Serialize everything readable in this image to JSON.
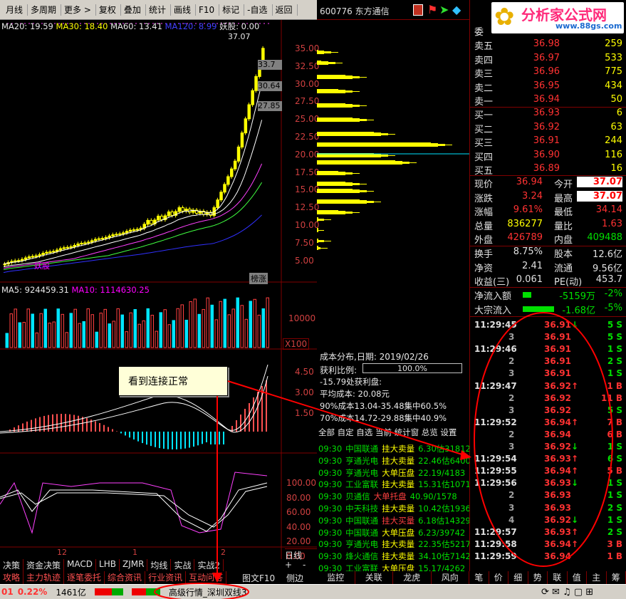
{
  "toolbar": {
    "items": [
      "月线",
      "多周期",
      "更多 >",
      "复权",
      "叠加",
      "统计",
      "画线",
      "F10",
      "标记",
      "-自选",
      "返回"
    ]
  },
  "stock": {
    "code_name": "600776 东方通信"
  },
  "logo": {
    "text": "分析家公式网",
    "url": "www.88gs.com"
  },
  "ma_line": {
    "ma20": "MA20: 19.59",
    "ma30": "MA30: 18.40",
    "ma60": "MA60: 13.41",
    "ma120": "MA120: 8.99",
    "yaogu": "妖股: 0.00"
  },
  "price_axis": [
    "35.00",
    "32.50",
    "30.00",
    "27.50",
    "25.00",
    "22.50",
    "20.00",
    "17.50",
    "15.00",
    "12.50",
    "10.00",
    "7.50",
    "5.00"
  ],
  "price_marks": {
    "high": "37.07",
    "p1": "33.7",
    "p2": "30.64",
    "p3": "27.85",
    "yaogu_label": "妖股",
    "tag": "榜涨"
  },
  "vol": {
    "ma5": "MA5: 924459.31",
    "ma10": "MA10: 1114630.25",
    "axis": "10000",
    "unit": "X100"
  },
  "macd_axis": [
    "4.50",
    "3.00",
    "1.50"
  ],
  "kdj_axis": [
    "100.00",
    "80.00",
    "60.00",
    "40.00",
    "20.00",
    "0.00"
  ],
  "x_labels": [
    "12",
    "1",
    "2"
  ],
  "annotation": {
    "text": "看到连接正常"
  },
  "cost": {
    "title": "成本分布,日期: 2019/02/26",
    "ratio_label": "获利比例:",
    "ratio_value": "100.0%",
    "lines": [
      "-15.79处获利盘:",
      "平均成本: 20.08元",
      "90%成本13.04-35.48集中60.5%",
      "70%成本14.72-29.88集中40.9%"
    ],
    "tabs": "全部 自定 自选 当前 统计窗 总览 设置"
  },
  "radar": [
    {
      "t": "09:30",
      "n": "中国联通",
      "k": "挂大卖量",
      "v": "6.30估31812"
    },
    {
      "t": "09:30",
      "n": "亨通光电",
      "k": "挂大卖量",
      "v": "22.46估6400"
    },
    {
      "t": "09:30",
      "n": "亨通光电",
      "k": "大单压盘",
      "v": "22.19/4183"
    },
    {
      "t": "09:30",
      "n": "工业富联",
      "k": "挂大卖量",
      "v": "15.31估1071"
    },
    {
      "t": "09:30",
      "n": "贝通信",
      "k": "大单托盘",
      "v": "40.90/1578"
    },
    {
      "t": "09:30",
      "n": "中天科技",
      "k": "挂大卖量",
      "v": "10.42估1936"
    },
    {
      "t": "09:30",
      "n": "中国联通",
      "k": "挂大买量",
      "v": "6.18估14329"
    },
    {
      "t": "09:30",
      "n": "中国联通",
      "k": "大单压盘",
      "v": "6.23/39742"
    },
    {
      "t": "09:30",
      "n": "亨通光电",
      "k": "挂大卖量",
      "v": "22.35估5217"
    },
    {
      "t": "09:30",
      "n": "烽火通信",
      "k": "挂大卖量",
      "v": "34.10估7142"
    },
    {
      "t": "09:30",
      "n": "工业富联",
      "k": "大单压盘",
      "v": "15.17/4262"
    }
  ],
  "order_book": {
    "header": "委",
    "sell": [
      {
        "l": "卖五",
        "p": "36.98",
        "v": "259"
      },
      {
        "l": "卖四",
        "p": "36.97",
        "v": "533"
      },
      {
        "l": "卖三",
        "p": "36.96",
        "v": "775"
      },
      {
        "l": "卖二",
        "p": "36.95",
        "v": "434"
      },
      {
        "l": "卖一",
        "p": "36.94",
        "v": "50"
      }
    ],
    "buy": [
      {
        "l": "买一",
        "p": "36.93",
        "v": "6"
      },
      {
        "l": "买二",
        "p": "36.92",
        "v": "63"
      },
      {
        "l": "买三",
        "p": "36.91",
        "v": "244"
      },
      {
        "l": "买四",
        "p": "36.90",
        "v": "116"
      },
      {
        "l": "买五",
        "p": "36.89",
        "v": "16"
      }
    ]
  },
  "quote": [
    [
      "现价",
      "36.94",
      "今开",
      "37.07"
    ],
    [
      "涨跌",
      "3.24",
      "最高",
      "37.07"
    ],
    [
      "涨幅",
      "9.61%",
      "最低",
      "34.14"
    ],
    [
      "总量",
      "836277",
      "量比",
      "1.63"
    ],
    [
      "外盘",
      "426789",
      "内盘",
      "409488"
    ]
  ],
  "stats": [
    [
      "换手",
      "8.75%",
      "股本",
      "12.6亿"
    ],
    [
      "净资",
      "2.41",
      "流通",
      "9.56亿"
    ],
    [
      "收益(三)",
      "0.061",
      "PE(动)",
      "453.7"
    ]
  ],
  "flow": [
    {
      "l": "净流入额",
      "v": "-5159万",
      "p": "-2%"
    },
    {
      "l": "大宗流入",
      "v": "-1.68亿",
      "p": "-5%"
    }
  ],
  "ticks": [
    {
      "t": "11:29:45",
      "p": "36.91",
      "d": "dn",
      "v": "5 S"
    },
    {
      "t": "3",
      "p": "36.91",
      "d": "",
      "v": "5 S"
    },
    {
      "t": "11:29:46",
      "p": "36.91",
      "d": "",
      "v": "1 S"
    },
    {
      "t": "2",
      "p": "36.91",
      "d": "",
      "v": "2 S"
    },
    {
      "t": "3",
      "p": "36.91",
      "d": "",
      "v": "1 S"
    },
    {
      "t": "11:29:47",
      "p": "36.92",
      "d": "up",
      "v": "1 B"
    },
    {
      "t": "2",
      "p": "36.92",
      "d": "",
      "v": "11 B"
    },
    {
      "t": "3",
      "p": "36.92",
      "d": "",
      "v": "5 S"
    },
    {
      "t": "11:29:52",
      "p": "36.94",
      "d": "up",
      "v": "7 B"
    },
    {
      "t": "2",
      "p": "36.94",
      "d": "",
      "v": "6 B"
    },
    {
      "t": "3",
      "p": "36.92",
      "d": "dn",
      "v": "1 S"
    },
    {
      "t": "11:29:54",
      "p": "36.93",
      "d": "up",
      "v": "6 S"
    },
    {
      "t": "11:29:55",
      "p": "36.94",
      "d": "up",
      "v": "5 B"
    },
    {
      "t": "11:29:56",
      "p": "36.93",
      "d": "dn",
      "v": "1 S"
    },
    {
      "t": "2",
      "p": "36.93",
      "d": "",
      "v": "1 S"
    },
    {
      "t": "3",
      "p": "36.93",
      "d": "",
      "v": "2 S"
    },
    {
      "t": "4",
      "p": "36.92",
      "d": "dn",
      "v": "1 S"
    },
    {
      "t": "11:29:57",
      "p": "36.93",
      "d": "up",
      "v": "2 S"
    },
    {
      "t": "11:29:58",
      "p": "36.94",
      "d": "up",
      "v": "3 B"
    },
    {
      "t": "11:29:59",
      "p": "36.94",
      "d": "",
      "v": "1 B"
    }
  ],
  "tabs_bottom1": [
    "决策",
    "资金决策",
    "MACD",
    "LHB",
    "ZJMR",
    "均线",
    "实战",
    "实战2"
  ],
  "tabs_bottom2": [
    "攻略",
    "主力轨迹",
    "逐笔委托",
    "综合资讯",
    "行业资讯",
    "互动问答"
  ],
  "side_btns": {
    "daily": "日线",
    "plus": "+",
    "minus": "-",
    "twf10": "图文F10",
    "side": "侧边"
  },
  "mid_tabs": [
    "监控",
    "关联",
    "龙虎",
    "风向"
  ],
  "right_tabs": [
    "笔",
    "价",
    "细",
    "势",
    "联",
    "值",
    "主",
    "筹"
  ],
  "status": {
    "idx": "01",
    "pct": "0.22%",
    "amt": "1461亿",
    "feed": "高级行情_深圳双线3"
  }
}
